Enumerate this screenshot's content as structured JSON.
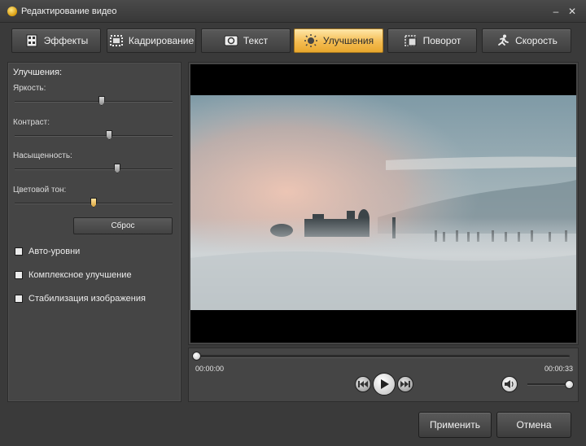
{
  "window": {
    "title": "Редактирование видео",
    "minimize_glyph": "–",
    "close_glyph": "✕"
  },
  "tabs": [
    {
      "label": "Эффекты",
      "icon": "effects-icon",
      "active": false
    },
    {
      "label": "Кадрирование",
      "icon": "crop-icon",
      "active": false
    },
    {
      "label": "Текст",
      "icon": "text-icon",
      "active": false
    },
    {
      "label": "Улучшения",
      "icon": "enhance-icon",
      "active": true
    },
    {
      "label": "Поворот",
      "icon": "rotate-icon",
      "active": false
    },
    {
      "label": "Скорость",
      "icon": "speed-icon",
      "active": false
    }
  ],
  "enhancements": {
    "section_title": "Улучшения:",
    "sliders": [
      {
        "label": "Яркость:",
        "value_fraction": 0.55
      },
      {
        "label": "Контраст:",
        "value_fraction": 0.6
      },
      {
        "label": "Насыщенность:",
        "value_fraction": 0.65
      },
      {
        "label": "Цветовой тон:",
        "value_fraction": 0.5
      }
    ],
    "reset_label": "Сброс",
    "checkboxes": [
      {
        "label": "Авто-уровни",
        "checked": false
      },
      {
        "label": "Комплексное улучшение",
        "checked": false
      },
      {
        "label": "Стабилизация изображения",
        "checked": false
      }
    ]
  },
  "player": {
    "time_current": "00:00:00",
    "time_total": "00:00:33",
    "seek_fraction": 0.0,
    "volume_fraction": 1.0
  },
  "footer": {
    "apply_label": "Применить",
    "cancel_label": "Отмена"
  },
  "colors": {
    "accent_active_tab": "#f4bc52",
    "panel_bg": "#454545",
    "window_bg": "#3a3a3a"
  }
}
